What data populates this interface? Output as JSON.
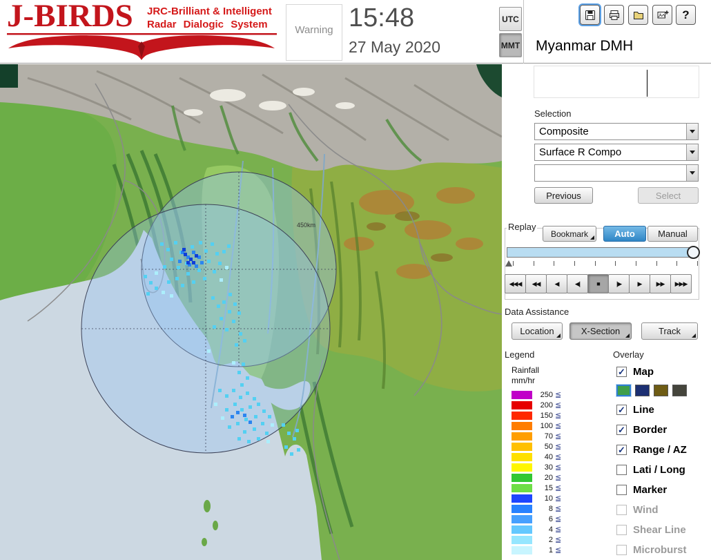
{
  "header": {
    "logo_title": "J-BIRDS",
    "logo_subtitle_line1": "JRC-Brilliant & Intelligent",
    "logo_subtitle_line2": "Radar Dialogic System",
    "warning_label": "Warning",
    "time": "15:48",
    "date": "27 May 2020",
    "timezone_buttons": {
      "utc": "UTC",
      "mmt": "MMT",
      "selected": "MMT"
    },
    "toolbar_icons": [
      "save",
      "print",
      "open",
      "capture",
      "help"
    ],
    "help_glyph": "?",
    "station_name": "Myanmar DMH"
  },
  "map": {
    "range_ring_label": "450km"
  },
  "selection": {
    "section_label": "Selection",
    "dropdowns": {
      "product_type": "Composite",
      "product": "Surface R Compo",
      "extra": ""
    },
    "previous_button": "Previous",
    "select_button": "Select"
  },
  "replay": {
    "section_label": "Replay",
    "bookmark_button": "Bookmark",
    "auto_button": "Auto",
    "manual_button": "Manual",
    "mode_selected": "Auto",
    "playback": [
      "◀◀◀",
      "◀◀",
      "◀",
      "◀|",
      "■",
      "|▶",
      "▶",
      "▶▶",
      "▶▶▶"
    ],
    "active_index": 4
  },
  "data_assistance": {
    "section_label": "Data Assistance",
    "location_button": "Location",
    "xsection_button": "X-Section",
    "track_button": "Track"
  },
  "legend": {
    "section_label": "Legend",
    "unit_line1": "Rainfall",
    "unit_line2": "mm/hr",
    "suffix": "≦",
    "rows": [
      {
        "value": "250",
        "color": "#c000c8"
      },
      {
        "value": "200",
        "color": "#e60000"
      },
      {
        "value": "150",
        "color": "#ff2800"
      },
      {
        "value": "100",
        "color": "#ff7d00"
      },
      {
        "value": "70",
        "color": "#ff9e00"
      },
      {
        "value": "50",
        "color": "#ffc000"
      },
      {
        "value": "40",
        "color": "#ffe000"
      },
      {
        "value": "30",
        "color": "#fff600"
      },
      {
        "value": "20",
        "color": "#32c832"
      },
      {
        "value": "15",
        "color": "#6ede46"
      },
      {
        "value": "10",
        "color": "#1e46ff"
      },
      {
        "value": "8",
        "color": "#2882ff"
      },
      {
        "value": "6",
        "color": "#46a0ff"
      },
      {
        "value": "4",
        "color": "#64c8ff"
      },
      {
        "value": "2",
        "color": "#96e6ff"
      },
      {
        "value": "1",
        "color": "#c8f5ff"
      }
    ]
  },
  "overlay": {
    "section_label": "Overlay",
    "selected_palette": 0,
    "map_palette": [
      "#3f9e4a",
      "#1c2f72",
      "#6e5c14",
      "#45453c"
    ],
    "items": [
      {
        "label": "Map",
        "checked": true,
        "disabled": false
      },
      {
        "label": "Line",
        "checked": true,
        "disabled": false
      },
      {
        "label": "Border",
        "checked": true,
        "disabled": false
      },
      {
        "label": "Range / AZ",
        "checked": true,
        "disabled": false
      },
      {
        "label": "Lati / Long",
        "checked": false,
        "disabled": false
      },
      {
        "label": "Marker",
        "checked": false,
        "disabled": false
      },
      {
        "label": "Wind",
        "checked": false,
        "disabled": true
      },
      {
        "label": "Shear Line",
        "checked": false,
        "disabled": true
      },
      {
        "label": "Microburst",
        "checked": false,
        "disabled": true
      }
    ]
  }
}
